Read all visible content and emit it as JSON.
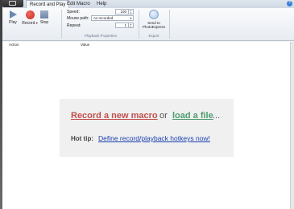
{
  "tabs": [
    "Record and Play",
    "Edit Macro",
    "Help"
  ],
  "ribbon": {
    "play": "Play",
    "record": "Record",
    "stop": "Stop",
    "speed_label": "Speed:",
    "speed_value": "100",
    "mouse_path_label": "Mouse path:",
    "mouse_path_value": "As recorded",
    "repeat_label": "Repeat:",
    "repeat_value": "1",
    "playback_group": "Playback Properties",
    "send_label_1": "Send to",
    "send_label_2": "PhotoExpress",
    "export_group": "Export"
  },
  "list": {
    "col_action": "Action",
    "col_value": "Value"
  },
  "welcome": {
    "record_link": "Record a new macro",
    "or": "or",
    "load_link": "load a file",
    "ellipsis": "...",
    "hot_tip": "Hot tip:",
    "hotkeys_link": "Define record/playback hotkeys now!"
  },
  "colors": {
    "record_link": "#c0504d",
    "load_link": "#4f9c6f",
    "hotkeys_link": "#1a3fb0"
  }
}
